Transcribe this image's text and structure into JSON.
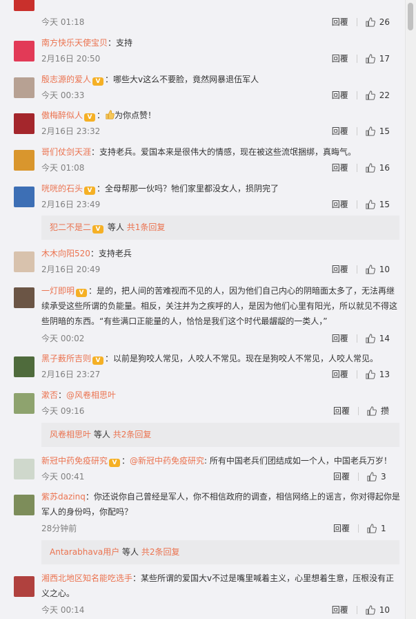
{
  "ui": {
    "reply_label": "回覆",
    "sub_prefix_suffix": "等人",
    "sub_replies_word": "回复"
  },
  "top_partial": {
    "text": "…",
    "time": "今天 01:18",
    "likes": "26"
  },
  "comments": [
    {
      "author": "南方快乐天使宝贝",
      "vip": false,
      "text": "支持",
      "time": "2月16日 20:50",
      "likes": "17"
    },
    {
      "author": "殷志源的爱人",
      "vip": true,
      "text": "哪些大v这么不要脸，竟然网暴退伍军人",
      "time": "今天 00:33",
      "likes": "22"
    },
    {
      "author": "傲梅醉似人",
      "vip": true,
      "text": "为你点赞！",
      "time": "2月16日 23:32",
      "likes": "15"
    },
    {
      "author": "哥们仗剑天涯",
      "vip": false,
      "text": "支持老兵。爱国本来是很伟大的情感，现在被这些流氓捆绑，真晦气。",
      "time": "今天 01:08",
      "likes": "16"
    },
    {
      "author": "咣咣的石头",
      "vip": true,
      "text": "全母帮那一伙吗？牠们家里都没女人，损阴完了",
      "time": "2月16日 23:49",
      "likes": "15",
      "sub": {
        "name": "犯二不是二",
        "count_text": "共1条回复"
      }
    },
    {
      "author": "木木向阳520",
      "vip": false,
      "text": "支持老兵",
      "time": "2月16日 20:49",
      "likes": "10"
    },
    {
      "author": "一灯即明",
      "vip": true,
      "text": "是的，把人间的苦难视而不见的人，因为他们自己内心的阴暗面太多了，无法再继续承受这些所谓的负能量。相反，关注并为之疾呼的人，是因为他们心里有阳光，所以就见不得这些阴暗的东西。“有些满口正能量的人，恰恰是我们这个时代最龌龊的一类人，”",
      "time": "今天 00:02",
      "likes": "14"
    },
    {
      "author": "黑子薮所吉则",
      "vip": true,
      "text": "以前是狗咬人常见，人咬人不常见。现在是狗咬人不常见，人咬人常见。",
      "time": "2月16日 23:27",
      "likes": "13"
    },
    {
      "author": "漱否",
      "vip": false,
      "mention": "@风卷相思叶",
      "text": "",
      "time": "今天 09:16",
      "likes": "攒",
      "sub": {
        "name": "风卷相思叶",
        "count_text": "共2条回复"
      }
    },
    {
      "author": "新冠中药免疫研究",
      "vip": true,
      "mention": "@新冠中药免疫研究",
      "text": ": 所有中国老兵们团结成如一个人，中国老兵万岁！",
      "time": "今天 00:41",
      "likes": "3"
    },
    {
      "author": "紫苏dazinq",
      "vip": false,
      "text": "你还说你自己曾经是军人，你不相信政府的调查，相信网络上的谣言，你对得起你是军人的身份吗，你配吗？",
      "time": "28分钟前",
      "likes": "1",
      "sub": {
        "name": "Antarabhava用户",
        "count_text": "共2条回复"
      }
    },
    {
      "author": "湘西北地区知名能吃选手",
      "vip": false,
      "text": "某些所谓的爱国大v不过是嘴里喊着主义，心里想着生意，压根没有正义之心。",
      "time": "今天 00:14",
      "likes": "10"
    }
  ],
  "colors": {
    "author": "#eb7350",
    "vip_badge": "#f5b025",
    "background": "#f2f2f5",
    "subreply_bg": "#eaeaec"
  }
}
